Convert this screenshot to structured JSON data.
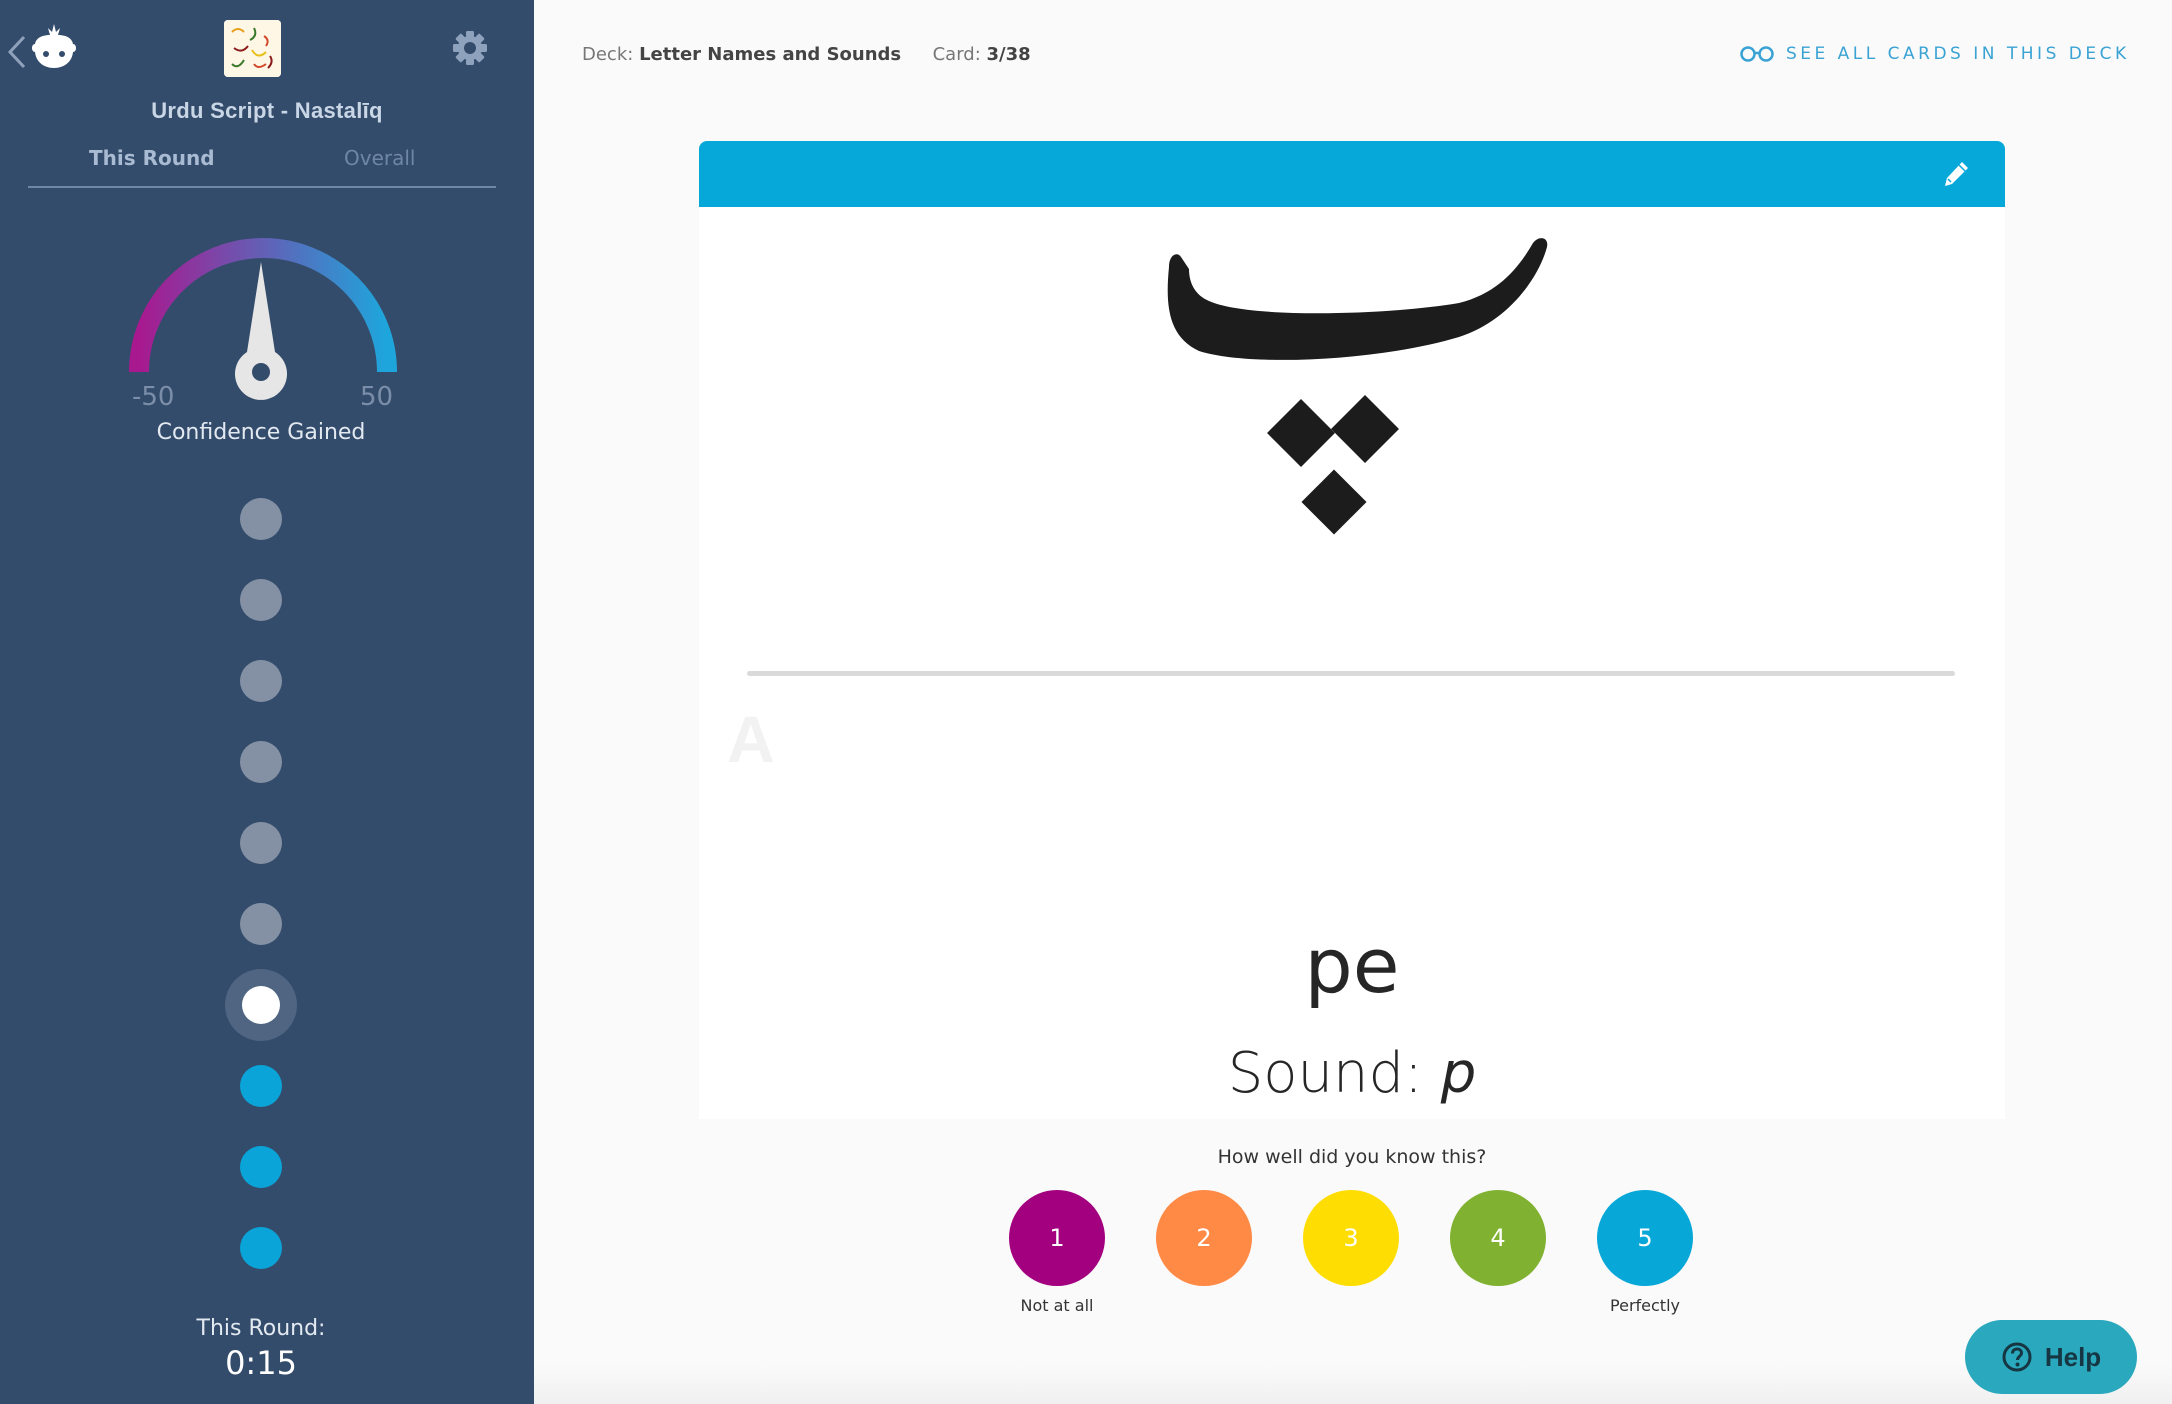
{
  "sidebar": {
    "deck_title": "Urdu Script - Nastalīq",
    "tabs": [
      {
        "label": "This Round",
        "active": true
      },
      {
        "label": "Overall",
        "active": false
      }
    ],
    "gauge": {
      "title": "Confidence Gained",
      "min_label": "-50",
      "max_label": "50",
      "min": -50,
      "max": 50,
      "value": 0,
      "colors": {
        "start": "#a8198f",
        "end": "#1ea6dc"
      }
    },
    "progress_dots": [
      {
        "state": "done"
      },
      {
        "state": "done"
      },
      {
        "state": "done"
      },
      {
        "state": "done"
      },
      {
        "state": "done"
      },
      {
        "state": "done"
      },
      {
        "state": "current"
      },
      {
        "state": "upcoming"
      },
      {
        "state": "upcoming"
      },
      {
        "state": "upcoming"
      }
    ],
    "round_label": "This Round:",
    "round_time": "0:15"
  },
  "header": {
    "deck_prefix": "Deck:",
    "deck_name": "Letter Names and Sounds",
    "card_prefix": "Card:",
    "card_position": "3/38",
    "see_all_label": "SEE ALL CARDS IN THIS DECK"
  },
  "card": {
    "question_glyph": "پ",
    "answer_marker": "A",
    "answer_name": "pe",
    "sound_prefix": "Sound:",
    "sound_value": "p",
    "accent": "#06a8d9"
  },
  "rating": {
    "question": "How well did you know this?",
    "buttons": [
      {
        "label": "1",
        "color": "#a3007f",
        "caption": "Not at all"
      },
      {
        "label": "2",
        "color": "#fe8a46",
        "caption": ""
      },
      {
        "label": "3",
        "color": "#fedd02",
        "caption": ""
      },
      {
        "label": "4",
        "color": "#80b131",
        "caption": ""
      },
      {
        "label": "5",
        "color": "#07a7d8",
        "caption": "Perfectly"
      }
    ]
  },
  "help": {
    "label": "Help"
  }
}
